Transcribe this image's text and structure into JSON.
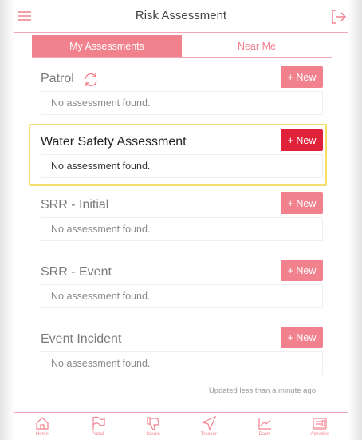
{
  "header": {
    "title": "Risk Assessment"
  },
  "tabs": [
    {
      "label": "My Assessments",
      "active": true
    },
    {
      "label": "Near Me",
      "active": false
    }
  ],
  "sections": [
    {
      "title": "Patrol",
      "new_label": "+ New",
      "empty_text": "No assessment found."
    },
    {
      "title": "Water Safety Assessment",
      "new_label": "+ New",
      "empty_text": "No assessment found."
    },
    {
      "title": "SRR - Initial",
      "new_label": "+ New",
      "empty_text": "No assessment found."
    },
    {
      "title": "SRR - Event",
      "new_label": "+ New",
      "empty_text": "No assessment found."
    },
    {
      "title": "Event Incident",
      "new_label": "+ New",
      "empty_text": "No assessment found."
    }
  ],
  "updated_text": "Updated less than a minute ago",
  "bottom_nav": [
    {
      "label": "Home",
      "icon": "home-icon"
    },
    {
      "label": "Patrol",
      "icon": "flag-icon"
    },
    {
      "label": "Issues",
      "icon": "thumbs-down-icon"
    },
    {
      "label": "Tracker",
      "icon": "navigation-icon"
    },
    {
      "label": "Dash",
      "icon": "chart-icon"
    },
    {
      "label": "Activities",
      "icon": "activities-icon"
    }
  ],
  "colors": {
    "accent": "#f2818e",
    "accent_active": "#e0223b",
    "highlight_border": "#f5de6a"
  }
}
